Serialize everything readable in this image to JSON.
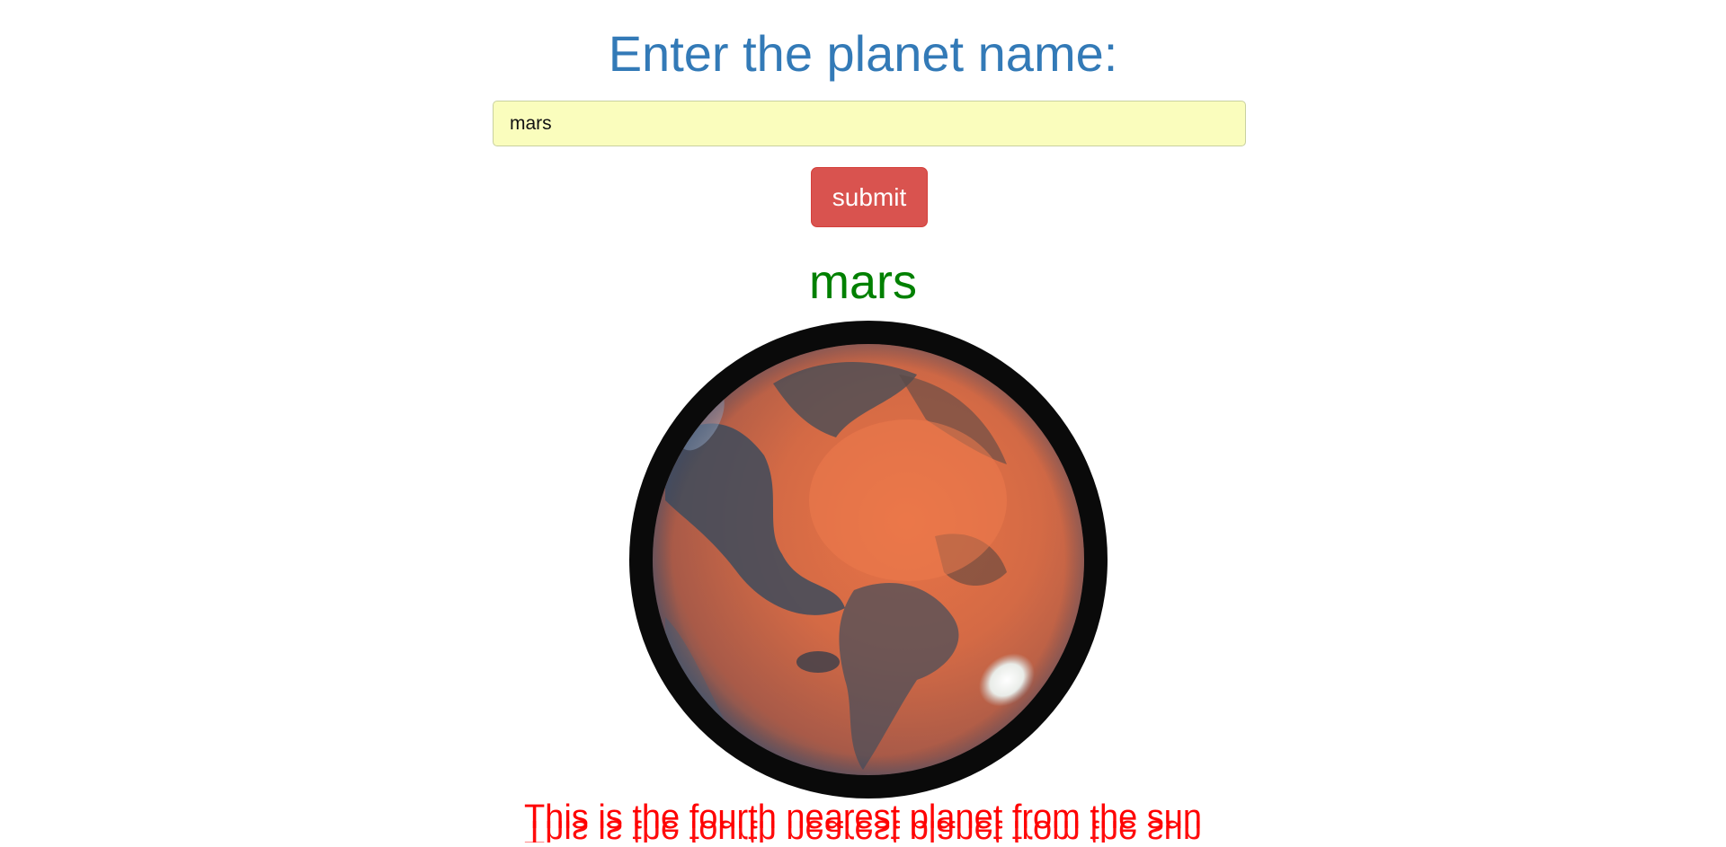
{
  "form": {
    "heading": "Enter the planet name:",
    "input_value": "mars",
    "submit_label": "submit"
  },
  "result": {
    "planet_name": "mars",
    "description": "This is the fourth nearest planet from the sun",
    "image_icon": "mars-planet-image"
  },
  "colors": {
    "heading": "#337ab7",
    "input_background": "#fafdbd",
    "button": "#d9534f",
    "planet_name": "#008000",
    "description": "#ff0000"
  }
}
